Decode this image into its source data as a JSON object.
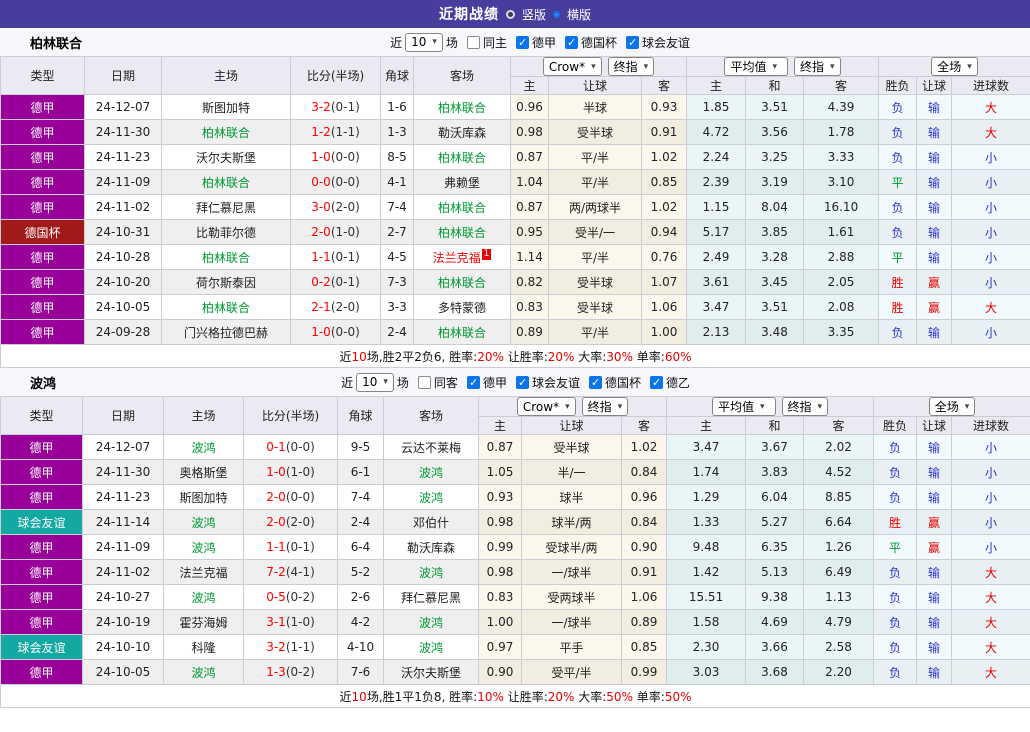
{
  "title_bar": {
    "title": "近期战绩",
    "vertical_label": "竖版",
    "horizontal_label": "横版"
  },
  "icons": {
    "caret": "▾",
    "checkmark": "✓"
  },
  "colors": {
    "titlebar": "#473d9c",
    "type": {
      "德甲": "#990099",
      "德国杯": "#a01a1a",
      "球会友谊": "#13a8a1"
    },
    "outcome": {
      "负": "#2b35cc",
      "平": "#009933",
      "胜": "#e60000",
      "输": "#2b35cc",
      "赢": "#e60000",
      "大": "#e60000",
      "小": "#2b35cc"
    }
  },
  "table": {
    "dropdowns": {
      "company": "Crow*",
      "final_a": "终指",
      "average": "平均值",
      "final_b": "终指",
      "full": "全场"
    },
    "left_columns": [
      "类型",
      "日期",
      "主场",
      "比分(半场)",
      "角球",
      "客场"
    ],
    "odds_columns": [
      "主",
      "让球",
      "客"
    ],
    "avg_columns": [
      "主",
      "和",
      "客"
    ],
    "result_columns": [
      "胜负",
      "让球",
      "进球数"
    ]
  },
  "filter_common": {
    "near": "近",
    "count": "10",
    "games": "场"
  },
  "sections": [
    {
      "team": "柏林联合",
      "same_filter": {
        "label": "同主",
        "checked": false
      },
      "leagues": [
        {
          "label": "德甲",
          "checked": true
        },
        {
          "label": "德国杯",
          "checked": true
        },
        {
          "label": "球会友谊",
          "checked": true
        }
      ],
      "rows": [
        {
          "lg": "德甲",
          "dt": "24-12-07",
          "hm": "斯图加特",
          "hc": "",
          "sc": "3-2",
          "hf": "(0-1)",
          "cn": "1-6",
          "aw": "柏林联合",
          "ac": "g",
          "as": "",
          "o": [
            "0.96",
            "半球",
            "0.93"
          ],
          "avg": [
            "1.85",
            "3.51",
            "4.39"
          ],
          "r": [
            "负",
            "输",
            "大"
          ]
        },
        {
          "lg": "德甲",
          "dt": "24-11-30",
          "hm": "柏林联合",
          "hc": "g",
          "sc": "1-2",
          "hf": "(1-1)",
          "cn": "1-3",
          "aw": "勒沃库森",
          "ac": "",
          "as": "",
          "o": [
            "0.98",
            "受半球",
            "0.91"
          ],
          "avg": [
            "4.72",
            "3.56",
            "1.78"
          ],
          "r": [
            "负",
            "输",
            "大"
          ]
        },
        {
          "lg": "德甲",
          "dt": "24-11-23",
          "hm": "沃尔夫斯堡",
          "hc": "",
          "sc": "1-0",
          "hf": "(0-0)",
          "cn": "8-5",
          "aw": "柏林联合",
          "ac": "g",
          "as": "",
          "o": [
            "0.87",
            "平/半",
            "1.02"
          ],
          "avg": [
            "2.24",
            "3.25",
            "3.33"
          ],
          "r": [
            "负",
            "输",
            "小"
          ]
        },
        {
          "lg": "德甲",
          "dt": "24-11-09",
          "hm": "柏林联合",
          "hc": "g",
          "sc": "0-0",
          "hf": "(0-0)",
          "cn": "4-1",
          "aw": "弗赖堡",
          "ac": "",
          "as": "",
          "o": [
            "1.04",
            "平/半",
            "0.85"
          ],
          "avg": [
            "2.39",
            "3.19",
            "3.10"
          ],
          "r": [
            "平",
            "输",
            "小"
          ]
        },
        {
          "lg": "德甲",
          "dt": "24-11-02",
          "hm": "拜仁慕尼黑",
          "hc": "",
          "sc": "3-0",
          "hf": "(2-0)",
          "cn": "7-4",
          "aw": "柏林联合",
          "ac": "g",
          "as": "",
          "o": [
            "0.87",
            "两/两球半",
            "1.02"
          ],
          "avg": [
            "1.15",
            "8.04",
            "16.10"
          ],
          "r": [
            "负",
            "输",
            "小"
          ]
        },
        {
          "lg": "德国杯",
          "dt": "24-10-31",
          "hm": "比勒菲尔德",
          "hc": "",
          "sc": "2-0",
          "hf": "(1-0)",
          "cn": "2-7",
          "aw": "柏林联合",
          "ac": "g",
          "as": "",
          "o": [
            "0.95",
            "受半/一",
            "0.94"
          ],
          "avg": [
            "5.17",
            "3.85",
            "1.61"
          ],
          "r": [
            "负",
            "输",
            "小"
          ]
        },
        {
          "lg": "德甲",
          "dt": "24-10-28",
          "hm": "柏林联合",
          "hc": "g",
          "sc": "1-1",
          "hf": "(0-1)",
          "cn": "4-5",
          "aw": "法兰克福",
          "ac": "r",
          "as": "1",
          "o": [
            "1.14",
            "平/半",
            "0.76"
          ],
          "avg": [
            "2.49",
            "3.28",
            "2.88"
          ],
          "r": [
            "平",
            "输",
            "小"
          ]
        },
        {
          "lg": "德甲",
          "dt": "24-10-20",
          "hm": "荷尔斯泰因",
          "hc": "",
          "sc": "0-2",
          "hf": "(0-1)",
          "cn": "7-3",
          "aw": "柏林联合",
          "ac": "g",
          "as": "",
          "o": [
            "0.82",
            "受半球",
            "1.07"
          ],
          "avg": [
            "3.61",
            "3.45",
            "2.05"
          ],
          "r": [
            "胜",
            "赢",
            "小"
          ]
        },
        {
          "lg": "德甲",
          "dt": "24-10-05",
          "hm": "柏林联合",
          "hc": "g",
          "sc": "2-1",
          "hf": "(2-0)",
          "cn": "3-3",
          "aw": "多特蒙德",
          "ac": "",
          "as": "",
          "o": [
            "0.83",
            "受半球",
            "1.06"
          ],
          "avg": [
            "3.47",
            "3.51",
            "2.08"
          ],
          "r": [
            "胜",
            "赢",
            "大"
          ]
        },
        {
          "lg": "德甲",
          "dt": "24-09-28",
          "hm": "门兴格拉德巴赫",
          "hc": "",
          "sc": "1-0",
          "hf": "(0-0)",
          "cn": "2-4",
          "aw": "柏林联合",
          "ac": "g",
          "as": "",
          "o": [
            "0.89",
            "平/半",
            "1.00"
          ],
          "avg": [
            "2.13",
            "3.48",
            "3.35"
          ],
          "r": [
            "负",
            "输",
            "小"
          ]
        }
      ],
      "summary": [
        {
          "text": "近",
          "red": false
        },
        {
          "text": "10",
          "red": true
        },
        {
          "text": "场,胜2平2负6, 胜率:",
          "red": false
        },
        {
          "text": "20%",
          "red": true
        },
        {
          "text": " 让胜率:",
          "red": false
        },
        {
          "text": "20%",
          "red": true
        },
        {
          "text": " 大率:",
          "red": false
        },
        {
          "text": "30%",
          "red": true
        },
        {
          "text": " 单率:",
          "red": false
        },
        {
          "text": "60%",
          "red": true
        }
      ]
    },
    {
      "team": "波鸿",
      "same_filter": {
        "label": "同客",
        "checked": false
      },
      "leagues": [
        {
          "label": "德甲",
          "checked": true
        },
        {
          "label": "球会友谊",
          "checked": true
        },
        {
          "label": "德国杯",
          "checked": true
        },
        {
          "label": "德乙",
          "checked": true
        }
      ],
      "rows": [
        {
          "lg": "德甲",
          "dt": "24-12-07",
          "hm": "波鸿",
          "hc": "g",
          "sc": "0-1",
          "hf": "(0-0)",
          "cn": "9-5",
          "aw": "云达不莱梅",
          "ac": "",
          "as": "",
          "o": [
            "0.87",
            "受半球",
            "1.02"
          ],
          "avg": [
            "3.47",
            "3.67",
            "2.02"
          ],
          "r": [
            "负",
            "输",
            "小"
          ]
        },
        {
          "lg": "德甲",
          "dt": "24-11-30",
          "hm": "奥格斯堡",
          "hc": "",
          "sc": "1-0",
          "hf": "(1-0)",
          "cn": "6-1",
          "aw": "波鸿",
          "ac": "g",
          "as": "",
          "o": [
            "1.05",
            "半/一",
            "0.84"
          ],
          "avg": [
            "1.74",
            "3.83",
            "4.52"
          ],
          "r": [
            "负",
            "输",
            "小"
          ]
        },
        {
          "lg": "德甲",
          "dt": "24-11-23",
          "hm": "斯图加特",
          "hc": "",
          "sc": "2-0",
          "hf": "(0-0)",
          "cn": "7-4",
          "aw": "波鸿",
          "ac": "g",
          "as": "",
          "o": [
            "0.93",
            "球半",
            "0.96"
          ],
          "avg": [
            "1.29",
            "6.04",
            "8.85"
          ],
          "r": [
            "负",
            "输",
            "小"
          ]
        },
        {
          "lg": "球会友谊",
          "dt": "24-11-14",
          "hm": "波鸿",
          "hc": "g",
          "sc": "2-0",
          "hf": "(2-0)",
          "cn": "2-4",
          "aw": "邓伯什",
          "ac": "",
          "as": "",
          "o": [
            "0.98",
            "球半/两",
            "0.84"
          ],
          "avg": [
            "1.33",
            "5.27",
            "6.64"
          ],
          "r": [
            "胜",
            "赢",
            "小"
          ]
        },
        {
          "lg": "德甲",
          "dt": "24-11-09",
          "hm": "波鸿",
          "hc": "g",
          "sc": "1-1",
          "hf": "(0-1)",
          "cn": "6-4",
          "aw": "勒沃库森",
          "ac": "",
          "as": "",
          "o": [
            "0.99",
            "受球半/两",
            "0.90"
          ],
          "avg": [
            "9.48",
            "6.35",
            "1.26"
          ],
          "r": [
            "平",
            "赢",
            "小"
          ]
        },
        {
          "lg": "德甲",
          "dt": "24-11-02",
          "hm": "法兰克福",
          "hc": "",
          "sc": "7-2",
          "hf": "(4-1)",
          "cn": "5-2",
          "aw": "波鸿",
          "ac": "g",
          "as": "",
          "o": [
            "0.98",
            "一/球半",
            "0.91"
          ],
          "avg": [
            "1.42",
            "5.13",
            "6.49"
          ],
          "r": [
            "负",
            "输",
            "大"
          ]
        },
        {
          "lg": "德甲",
          "dt": "24-10-27",
          "hm": "波鸿",
          "hc": "g",
          "sc": "0-5",
          "hf": "(0-2)",
          "cn": "2-6",
          "aw": "拜仁慕尼黑",
          "ac": "",
          "as": "",
          "o": [
            "0.83",
            "受两球半",
            "1.06"
          ],
          "avg": [
            "15.51",
            "9.38",
            "1.13"
          ],
          "r": [
            "负",
            "输",
            "大"
          ]
        },
        {
          "lg": "德甲",
          "dt": "24-10-19",
          "hm": "霍芬海姆",
          "hc": "",
          "sc": "3-1",
          "hf": "(1-0)",
          "cn": "4-2",
          "aw": "波鸿",
          "ac": "g",
          "as": "",
          "o": [
            "1.00",
            "一/球半",
            "0.89"
          ],
          "avg": [
            "1.58",
            "4.69",
            "4.79"
          ],
          "r": [
            "负",
            "输",
            "大"
          ]
        },
        {
          "lg": "球会友谊",
          "dt": "24-10-10",
          "hm": "科隆",
          "hc": "",
          "sc": "3-2",
          "hf": "(1-1)",
          "cn": "4-10",
          "aw": "波鸿",
          "ac": "g",
          "as": "",
          "o": [
            "0.97",
            "平手",
            "0.85"
          ],
          "avg": [
            "2.30",
            "3.66",
            "2.58"
          ],
          "r": [
            "负",
            "输",
            "大"
          ]
        },
        {
          "lg": "德甲",
          "dt": "24-10-05",
          "hm": "波鸿",
          "hc": "g",
          "sc": "1-3",
          "hf": "(0-2)",
          "cn": "7-6",
          "aw": "沃尔夫斯堡",
          "ac": "",
          "as": "",
          "o": [
            "0.90",
            "受平/半",
            "0.99"
          ],
          "avg": [
            "3.03",
            "3.68",
            "2.20"
          ],
          "r": [
            "负",
            "输",
            "大"
          ]
        }
      ],
      "summary": [
        {
          "text": "近",
          "red": false
        },
        {
          "text": "10",
          "red": true
        },
        {
          "text": "场,胜1平1负8, 胜率:",
          "red": false
        },
        {
          "text": "10%",
          "red": true
        },
        {
          "text": " 让胜率:",
          "red": false
        },
        {
          "text": "20%",
          "red": true
        },
        {
          "text": " 大率:",
          "red": false
        },
        {
          "text": "50%",
          "red": true
        },
        {
          "text": " 单率:",
          "red": false
        },
        {
          "text": "50%",
          "red": true
        }
      ]
    }
  ]
}
